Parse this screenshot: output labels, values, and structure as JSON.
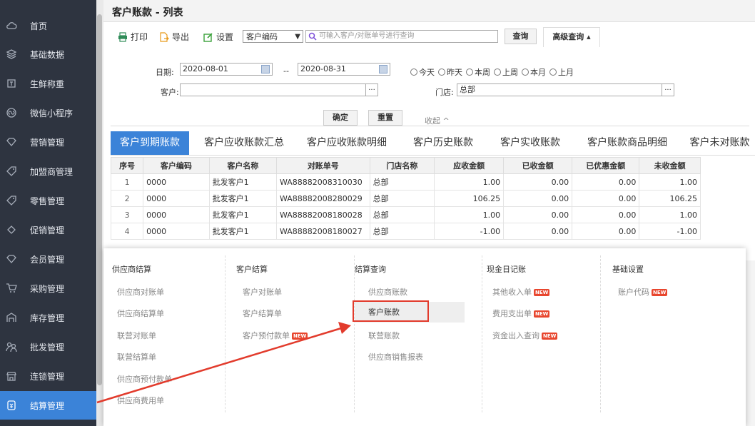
{
  "sidebar": {
    "items": [
      {
        "label": "首页",
        "icon": "cloud-icon"
      },
      {
        "label": "基础数据",
        "icon": "layers-icon"
      },
      {
        "label": "生鲜称重",
        "icon": "scale-icon"
      },
      {
        "label": "微信小程序",
        "icon": "mini-program-icon"
      },
      {
        "label": "营销管理",
        "icon": "diamond-icon"
      },
      {
        "label": "加盟商管理",
        "icon": "tag-icon"
      },
      {
        "label": "零售管理",
        "icon": "tag-icon"
      },
      {
        "label": "促销管理",
        "icon": "tag-icon"
      },
      {
        "label": "会员管理",
        "icon": "diamond-icon"
      },
      {
        "label": "采购管理",
        "icon": "cart-icon"
      },
      {
        "label": "库存管理",
        "icon": "warehouse-icon"
      },
      {
        "label": "批发管理",
        "icon": "people-icon"
      },
      {
        "label": "连锁管理",
        "icon": "store-icon"
      },
      {
        "label": "结算管理",
        "icon": "wallet-icon"
      }
    ],
    "active_color": "#3b83d8"
  },
  "page": {
    "title": "客户账款 - 列表"
  },
  "toolbar": {
    "print_label": "打印",
    "export_label": "导出",
    "settings_label": "设置",
    "select_value": "客户编码",
    "search_placeholder": "可输入客户/对账单号进行查询",
    "query_label": "查询",
    "advanced_label": "高级查询 ▴"
  },
  "filter": {
    "date_label": "日期:",
    "date_from": "2020-08-01",
    "date_sep": "--",
    "date_to": "2020-08-31",
    "quick_ranges": [
      "今天",
      "昨天",
      "本周",
      "上周",
      "本月",
      "上月"
    ],
    "customer_label": "客户:",
    "customer_value": "",
    "store_label": "门店:",
    "store_value": "总部",
    "dots": "...",
    "confirm_label": "确定",
    "reset_label": "重置",
    "collapse_label": "收起 ^"
  },
  "tabs": [
    {
      "label": "客户到期账款",
      "active": true
    },
    {
      "label": "客户应收账款汇总",
      "active": false
    },
    {
      "label": "客户应收账款明细",
      "active": false
    },
    {
      "label": "客户历史账款",
      "active": false
    },
    {
      "label": "客户实收账款",
      "active": false
    },
    {
      "label": "客户账款商品明细",
      "active": false
    },
    {
      "label": "客户未对账款",
      "active": false
    }
  ],
  "table": {
    "columns": [
      "序号",
      "客户编码",
      "客户名称",
      "对账单号",
      "门店名称",
      "应收金额",
      "已收金额",
      "已优惠金额",
      "未收金额"
    ],
    "rows": [
      [
        "1",
        "0000",
        "批发客户1",
        "WA88882008310030",
        "总部",
        "1.00",
        "0.00",
        "0.00",
        "1.00"
      ],
      [
        "2",
        "0000",
        "批发客户1",
        "WA88882008280029",
        "总部",
        "106.25",
        "0.00",
        "0.00",
        "106.25"
      ],
      [
        "3",
        "0000",
        "批发客户1",
        "WA88882008180028",
        "总部",
        "1.00",
        "0.00",
        "0.00",
        "1.00"
      ],
      [
        "4",
        "0000",
        "批发客户1",
        "WA88882008180027",
        "总部",
        "-1.00",
        "0.00",
        "0.00",
        "-1.00"
      ]
    ]
  },
  "mega_menu": {
    "new_badge": "NEW",
    "columns": [
      {
        "title": "供应商结算",
        "items": [
          {
            "label": "供应商对账单",
            "new": false
          },
          {
            "label": "供应商结算单",
            "new": false
          },
          {
            "label": "联营对账单",
            "new": false
          },
          {
            "label": "联营结算单",
            "new": false
          },
          {
            "label": "供应商预付款单",
            "new": false
          },
          {
            "label": "供应商费用单",
            "new": false
          }
        ]
      },
      {
        "title": "客户结算",
        "items": [
          {
            "label": "客户对账单",
            "new": false
          },
          {
            "label": "客户结算单",
            "new": false
          },
          {
            "label": "客户预付款单",
            "new": true
          }
        ]
      },
      {
        "title": "结算查询",
        "items": [
          {
            "label": "供应商账款",
            "new": false
          },
          {
            "label": "客户账款",
            "new": false,
            "selected": true
          },
          {
            "label": "联营账款",
            "new": false
          },
          {
            "label": "供应商销售报表",
            "new": false
          }
        ]
      },
      {
        "title": "现金日记账",
        "items": [
          {
            "label": "其他收入单",
            "new": true
          },
          {
            "label": "费用支出单",
            "new": true
          },
          {
            "label": "资金出入查询",
            "new": true
          }
        ]
      },
      {
        "title": "基础设置",
        "items": [
          {
            "label": "账户代码",
            "new": true
          }
        ]
      }
    ]
  },
  "annotation": {
    "highlight_color": "#e23b2c"
  }
}
